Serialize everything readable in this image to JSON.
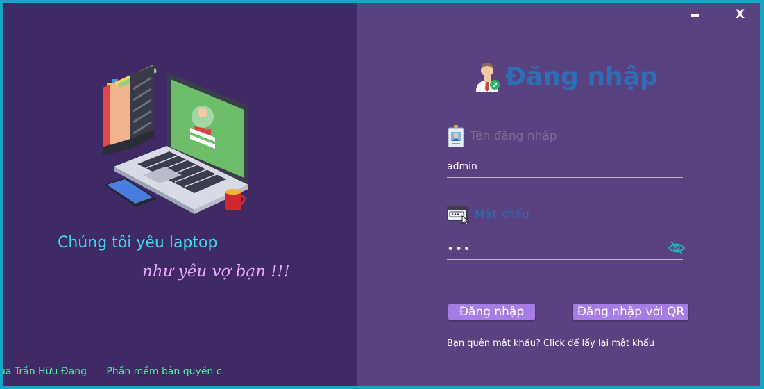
{
  "window": {
    "minimize_icon": "minimize-icon",
    "close_label": "X"
  },
  "brand": {
    "illustration": "laptop-illustration",
    "tagline_1": "Chúng tôi yêu laptop",
    "tagline_2": "như yêu vợ bạn !!!",
    "footer_author": "ủa Trần Hữu Đang",
    "footer_copyright": "Phần mềm bản quyền c"
  },
  "login": {
    "title": "Đăng nhập",
    "title_icon": "user-check-icon",
    "username_label": "Tên đăng nhập",
    "username_icon": "id-badge-icon",
    "username_value": "admin",
    "password_label": "Mật khẩu",
    "password_icon": "password-window-icon",
    "password_value": "•••",
    "eye_icon": "eye-slash-icon",
    "login_button": "Đăng nhập",
    "qr_button": "Đăng nhập với QR",
    "forgot_link": "Bạn quên mật khẩu? Click để lấy lại mật khẩu"
  },
  "colors": {
    "frame": "#17a6c5",
    "left_panel": "#3f2a66",
    "right_panel": "#5a4180",
    "title": "#2f6db4",
    "button": "#a57de4",
    "tagline_1": "#40d7ef",
    "tagline_2": "#e8a8ff",
    "footer": "#58e5a8"
  }
}
